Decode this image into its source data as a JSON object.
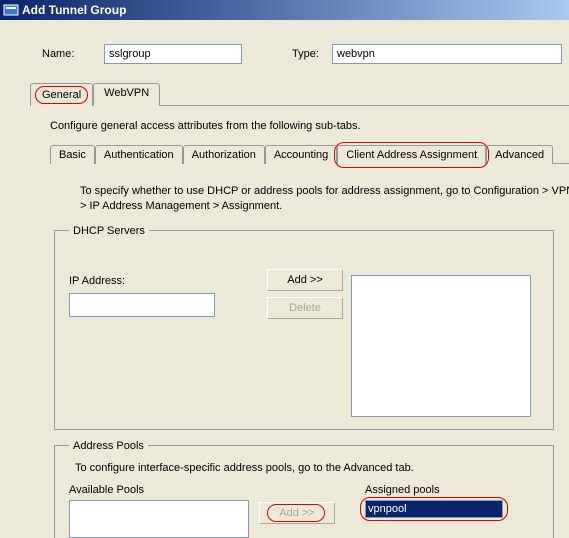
{
  "window": {
    "title": "Add Tunnel Group"
  },
  "form": {
    "name_label": "Name:",
    "name_value": "sslgroup",
    "type_label": "Type:",
    "type_value": "webvpn"
  },
  "outer_tabs": {
    "general": "General",
    "webvpn": "WebVPN"
  },
  "intro": "Configure general access attributes from the following sub-tabs.",
  "inner_tabs": {
    "basic": "Basic",
    "authentication": "Authentication",
    "authorization": "Authorization",
    "accounting": "Accounting",
    "client_addr": "Client Address Assignment",
    "advanced": "Advanced"
  },
  "instruction": "To specify whether to use DHCP or address pools for address assignment, go to Configuration > VPN > IP Address Management > Assignment.",
  "dhcp": {
    "legend": "DHCP Servers",
    "ip_label": "IP Address:",
    "ip_value": "",
    "add_btn": "Add >>",
    "delete_btn": "Delete"
  },
  "pools": {
    "legend": "Address Pools",
    "instr": "To configure interface-specific address pools, go to the Advanced tab.",
    "available_label": "Available Pools",
    "assigned_label": "Assigned pools",
    "add_btn": "Add >>",
    "assigned_items": [
      "vpnpool"
    ]
  }
}
